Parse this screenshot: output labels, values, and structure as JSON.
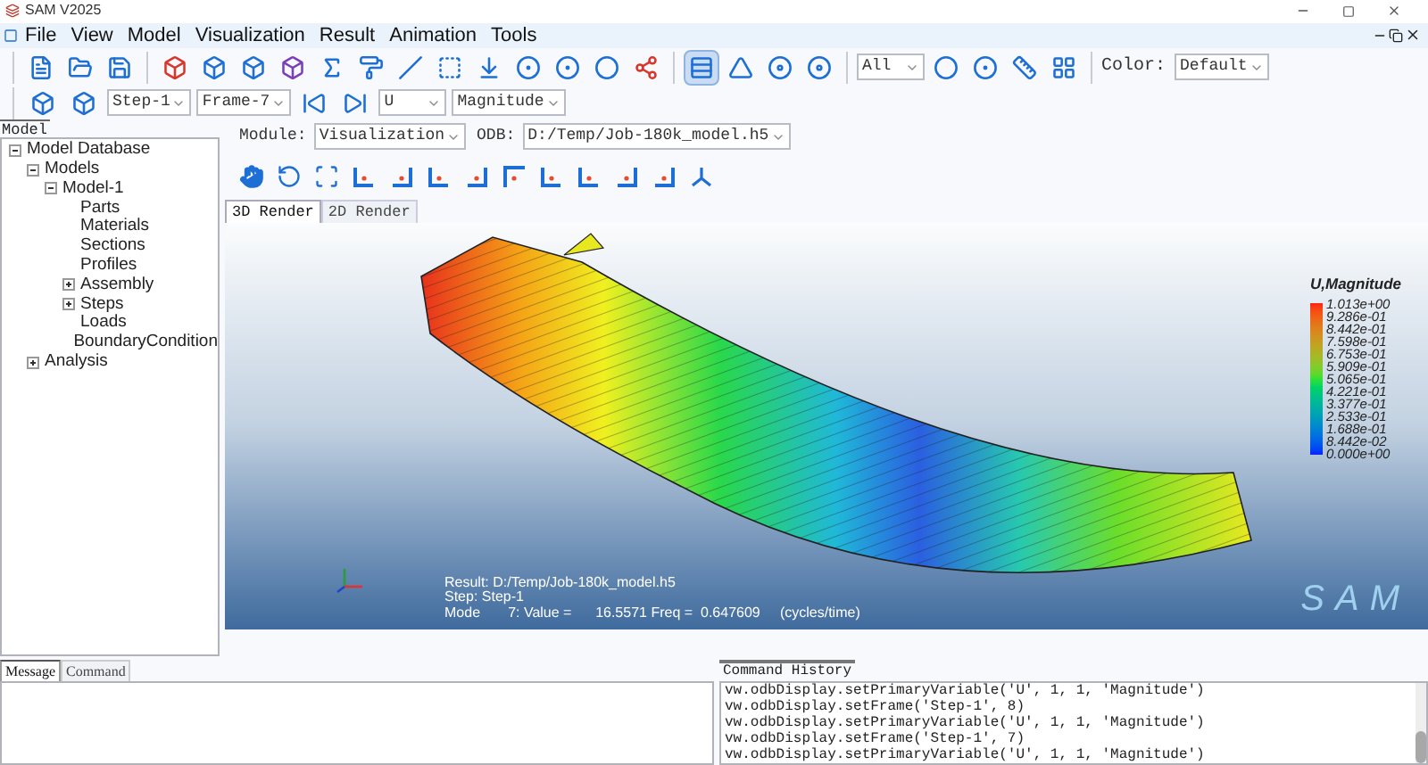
{
  "window": {
    "title": "SAM V2025"
  },
  "menu": [
    "File",
    "View",
    "Model",
    "Visualization",
    "Result",
    "Animation",
    "Tools"
  ],
  "toolbar_1": {
    "tools": [
      {
        "selected": false
      },
      {
        "selected": false
      },
      {
        "selected": false
      },
      {
        "selected": false
      },
      {
        "selected": false
      },
      {
        "selected": false
      },
      {
        "selected": false
      },
      {
        "selected": false
      },
      {
        "selected": false
      },
      {
        "selected": false
      },
      {
        "selected": false
      },
      {
        "selected": false
      },
      {
        "selected": false
      },
      {
        "selected": false
      },
      {
        "selected": false
      },
      {
        "selected": false
      },
      {
        "selected": true
      },
      {
        "selected": false
      },
      {
        "selected": false
      },
      {
        "selected": false
      }
    ],
    "filter_select": {
      "value": "All"
    },
    "color_label": "Color:",
    "color_select": {
      "value": "Default"
    }
  },
  "toolbar_2": {
    "step_select": {
      "value": "Step-1"
    },
    "frame_select": {
      "value": "Frame-7"
    },
    "variable_select": {
      "value": "U"
    },
    "component_select": {
      "value": "Magnitude"
    }
  },
  "model_panel": {
    "tab": "Model",
    "tree": [
      {
        "label": "Model Database",
        "expanded": true,
        "children": [
          {
            "label": "Models",
            "expanded": true,
            "children": [
              {
                "label": "Model-1",
                "expanded": true,
                "children": [
                  {
                    "label": "Parts"
                  },
                  {
                    "label": "Materials"
                  },
                  {
                    "label": "Sections"
                  },
                  {
                    "label": "Profiles"
                  },
                  {
                    "label": "Assembly",
                    "expanded": false
                  },
                  {
                    "label": "Steps",
                    "expanded": false
                  },
                  {
                    "label": "Loads"
                  },
                  {
                    "label": "BoundaryCondition"
                  }
                ]
              }
            ]
          },
          {
            "label": "Analysis",
            "expanded": false
          }
        ]
      }
    ]
  },
  "module_bar": {
    "module_label": "Module:",
    "module_select": {
      "value": "Visualization"
    },
    "odb_label": "ODB:",
    "odb_select": {
      "value": "D:/Temp/Job-180k_model.h5"
    }
  },
  "render_tabs": [
    {
      "label": "3D Render",
      "selected": true
    },
    {
      "label": "2D Render",
      "selected": false
    }
  ],
  "viewport": {
    "legend": {
      "title": "U,Magnitude",
      "labels": [
        "1.013e+00",
        "9.286e-01",
        "8.442e-01",
        "7.598e-01",
        "6.753e-01",
        "5.909e-01",
        "5.065e-01",
        "4.221e-01",
        "3.377e-01",
        "2.533e-01",
        "1.688e-01",
        "8.442e-02",
        "0.000e+00"
      ]
    },
    "info_lines": [
      "Result: D:/Temp/Job-180k_model.h5",
      "Step: Step-1",
      "Mode       7: Value =      16.5571 Freq =  0.647609     (cycles/time)"
    ],
    "logo": "SAM"
  },
  "bottom_tabs": [
    {
      "label": "Message",
      "selected": true
    },
    {
      "label": "Command",
      "selected": false
    }
  ],
  "command_history": {
    "title": "Command History",
    "lines": [
      "vw.odbDisplay.setPrimaryVariable('U', 1, 1, 'Magnitude')",
      "vw.odbDisplay.setFrame('Step-1', 8)",
      "vw.odbDisplay.setPrimaryVariable('U', 1, 1, 'Magnitude')",
      "vw.odbDisplay.setFrame('Step-1', 7)",
      "vw.odbDisplay.setPrimaryVariable('U', 1, 1, 'Magnitude')"
    ]
  }
}
